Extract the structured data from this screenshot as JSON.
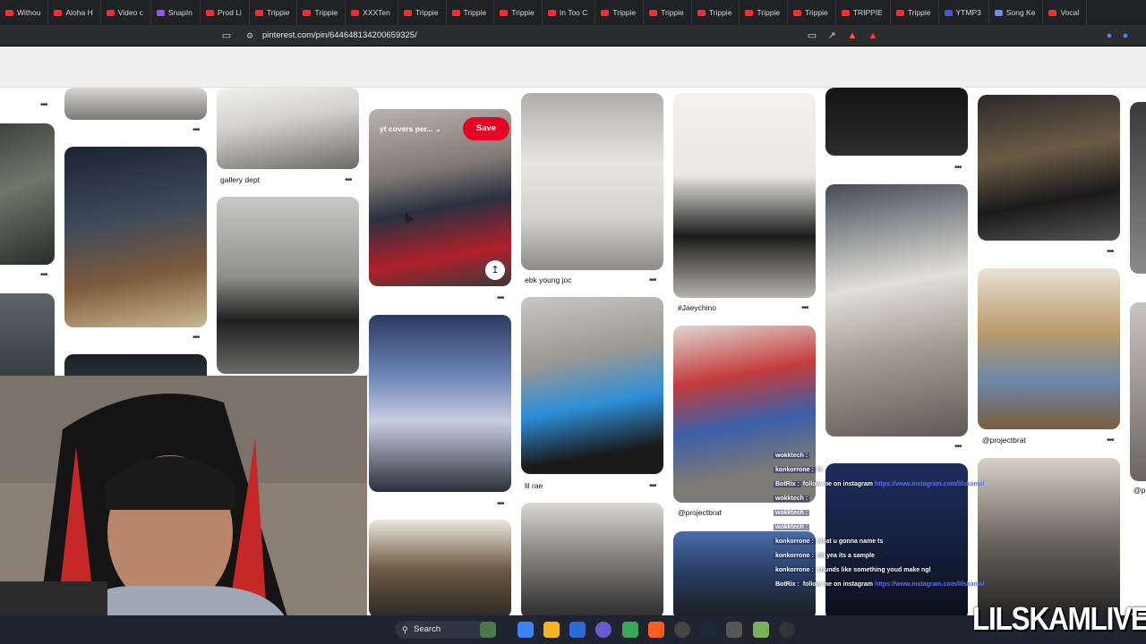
{
  "browser": {
    "tabs": [
      {
        "label": "Withou",
        "color": "#ff2b2b"
      },
      {
        "label": "Aloha H",
        "color": "#ff2b2b"
      },
      {
        "label": "Video c",
        "color": "#ff2b2b"
      },
      {
        "label": "SnapIn",
        "color": "#9b4dff"
      },
      {
        "label": "Prod Li",
        "color": "#ff2b2b"
      },
      {
        "label": "Trippie",
        "color": "#ff2b2b"
      },
      {
        "label": "Trippie",
        "color": "#ff2b2b"
      },
      {
        "label": "XXXTen",
        "color": "#ff2b2b"
      },
      {
        "label": "Trippie",
        "color": "#ff2b2b"
      },
      {
        "label": "Trippie",
        "color": "#ff2b2b"
      },
      {
        "label": "Trippie",
        "color": "#ff2b2b"
      },
      {
        "label": "In Too C",
        "color": "#ff2b2b"
      },
      {
        "label": "Trippie",
        "color": "#ff2b2b"
      },
      {
        "label": "Trippie",
        "color": "#ff2b2b"
      },
      {
        "label": "Trippie",
        "color": "#ff2b2b"
      },
      {
        "label": "Trippie",
        "color": "#ff2b2b"
      },
      {
        "label": "Trippie",
        "color": "#ff2b2b"
      },
      {
        "label": "TRIPPIE",
        "color": "#ff2b2b"
      },
      {
        "label": "Trippie",
        "color": "#ff2b2b"
      },
      {
        "label": "YTMP3",
        "color": "#3b5bdb"
      },
      {
        "label": "Song Ke",
        "color": "#6a8cff"
      },
      {
        "label": "Vocal",
        "color": "#ff2b2b"
      }
    ],
    "url": "pinterest.com/pin/644648134200659325/",
    "icons": [
      "bookmark-icon",
      "site-info-icon",
      "cast-icon",
      "share-icon",
      "brave-shield-icon",
      "brave-rewards-icon"
    ]
  },
  "pin_overlay": {
    "board_label": "yt covers per...",
    "save_label": "Save",
    "share_icon": "upload-icon"
  },
  "captions": {
    "c1": "gallery dept",
    "c2": "ebk young joc",
    "c3": "#Jaeychino",
    "c4": "@projectbrat",
    "c5": "lil rae",
    "c6": "@projectbrat",
    "c7": "@p"
  },
  "chat": {
    "lines": [
      {
        "name": "wokktech :",
        "msg": "",
        "url": ""
      },
      {
        "name": "konkorrone :",
        "msg": "lx",
        "url": ""
      },
      {
        "name": "BotRix :",
        "msg": "follow me on instagram",
        "url": "https://www.instagram.com/lilskamx/"
      },
      {
        "name": "wokktech :",
        "msg": "",
        "url": ""
      },
      {
        "name": "wokktech :",
        "msg": "",
        "url": ""
      },
      {
        "name": "wokktech :",
        "msg": "",
        "url": ""
      },
      {
        "name": "konkorrone :",
        "msg": "what u gonna name ts",
        "url": ""
      },
      {
        "name": "konkorrone :",
        "msg": "oh yea its a sample",
        "url": ""
      },
      {
        "name": "konkorrone :",
        "msg": "sounds like something youd make ngl",
        "url": ""
      },
      {
        "name": "BotRix :",
        "msg": "follow me on instagram",
        "url": "https://www.instagram.com/lilskamx/"
      }
    ]
  },
  "taskbar": {
    "search_label": "Search"
  },
  "watermark": "LILSKAMLIVE",
  "colors": {
    "pinterest_red": "#e60023",
    "tabbar_bg": "#202124",
    "taskbar_bg": "#1f2430"
  }
}
